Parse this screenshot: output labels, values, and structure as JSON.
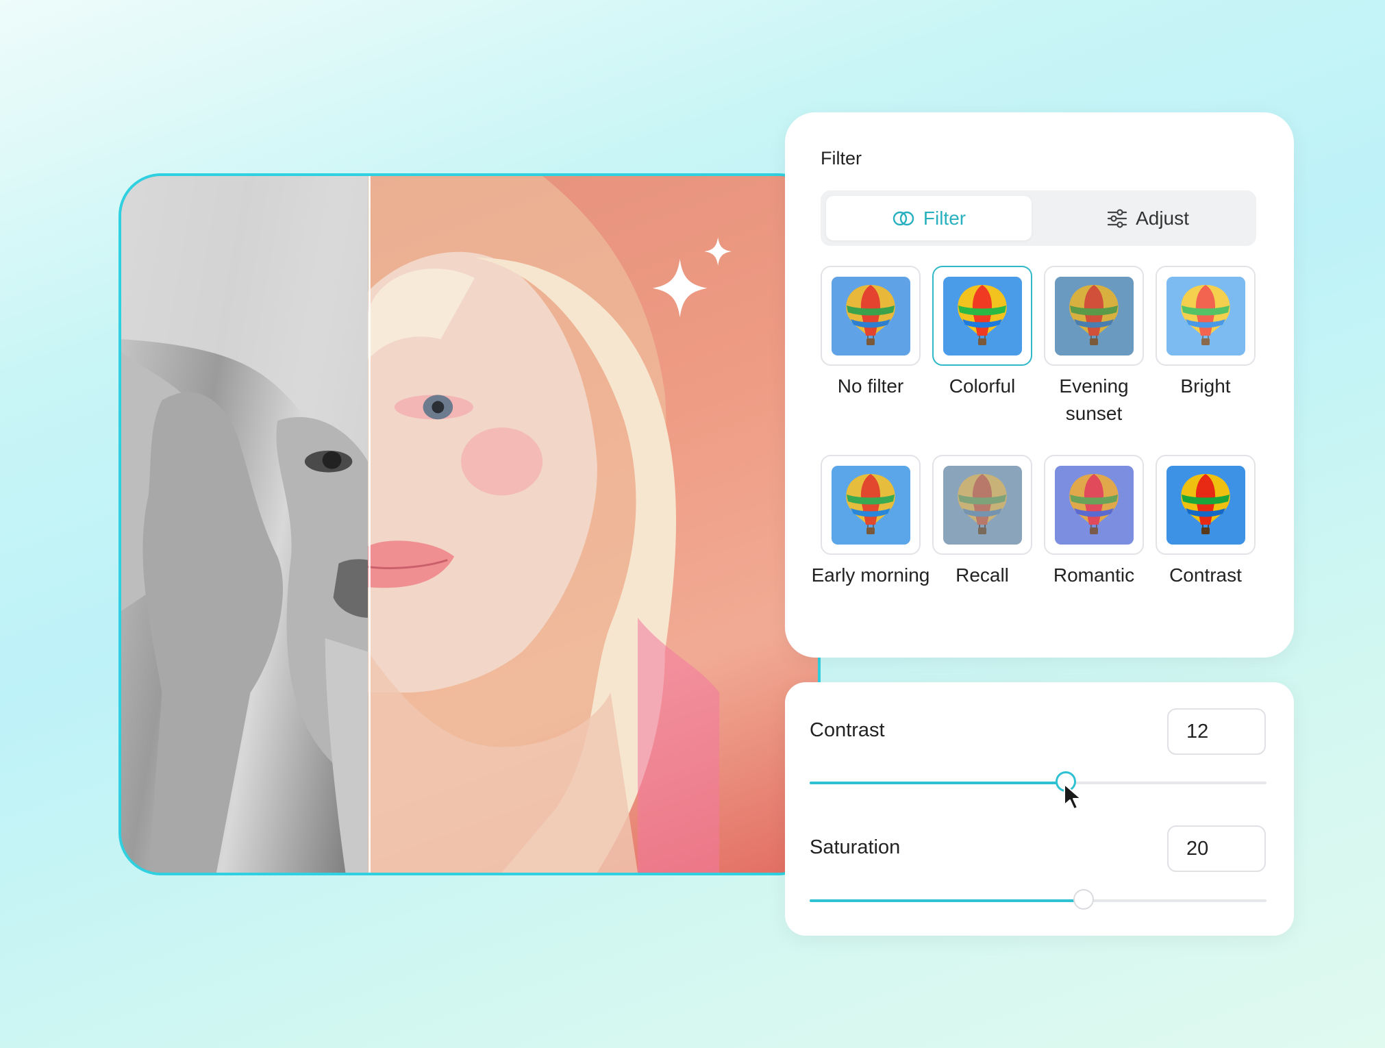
{
  "filter_panel": {
    "title": "Filter",
    "tabs": [
      {
        "label": "Filter",
        "icon": "overlap-circles-icon",
        "active": true
      },
      {
        "label": "Adjust",
        "icon": "sliders-icon",
        "active": false
      }
    ],
    "filters": [
      {
        "label": "No filter",
        "selected": false,
        "tint": "none"
      },
      {
        "label": "Colorful",
        "selected": true,
        "tint": "vivid"
      },
      {
        "label": "Evening sunset",
        "selected": false,
        "tint": "warm-muted"
      },
      {
        "label": "Bright",
        "selected": false,
        "tint": "bright"
      },
      {
        "label": "Early morning",
        "selected": false,
        "tint": "cool"
      },
      {
        "label": "Recall",
        "selected": false,
        "tint": "faded"
      },
      {
        "label": "Romantic",
        "selected": false,
        "tint": "purple"
      },
      {
        "label": "Contrast",
        "selected": false,
        "tint": "high-contrast"
      }
    ]
  },
  "adjust_panel": {
    "contrast": {
      "label": "Contrast",
      "value": "12",
      "level": 0.56
    },
    "saturation": {
      "label": "Saturation",
      "value": "20",
      "level": 0.6
    }
  },
  "colors": {
    "accent": "#2ec1d2",
    "frame_border": "#2fd0e0",
    "selected_border": "#2fb8c7"
  }
}
